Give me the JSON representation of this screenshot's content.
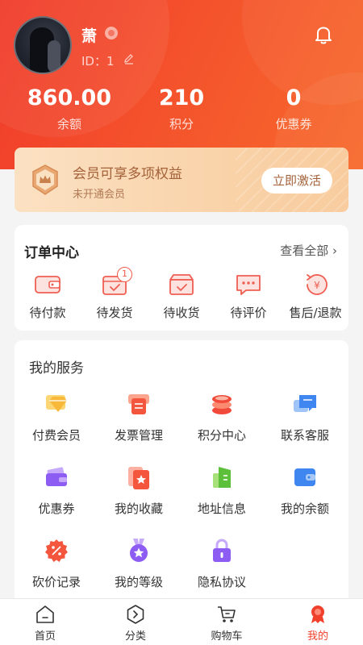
{
  "profile": {
    "username": "萧",
    "id_label": "ID：",
    "id_value": "1"
  },
  "stats": [
    {
      "value": "860.00",
      "label": "余额"
    },
    {
      "value": "210",
      "label": "积分"
    },
    {
      "value": "0",
      "label": "优惠券"
    }
  ],
  "member_banner": {
    "title": "会员可享多项权益",
    "subtitle": "未开通会员",
    "button": "立即激活"
  },
  "orders": {
    "title": "订单中心",
    "more": "查看全部",
    "items": [
      {
        "label": "待付款",
        "icon": "wallet-icon"
      },
      {
        "label": "待发货",
        "icon": "pending-ship-icon",
        "badge": "1"
      },
      {
        "label": "待收货",
        "icon": "receive-box-icon"
      },
      {
        "label": "待评价",
        "icon": "comment-icon"
      },
      {
        "label": "售后/退款",
        "icon": "refund-icon"
      }
    ]
  },
  "services": {
    "title": "我的服务",
    "items": [
      {
        "label": "付费会员",
        "icon": "diamond-icon"
      },
      {
        "label": "发票管理",
        "icon": "invoice-icon"
      },
      {
        "label": "积分中心",
        "icon": "coins-icon"
      },
      {
        "label": "联系客服",
        "icon": "chat-bubbles-icon"
      },
      {
        "label": "优惠券",
        "icon": "coupon-wallet-icon"
      },
      {
        "label": "我的收藏",
        "icon": "star-card-icon"
      },
      {
        "label": "地址信息",
        "icon": "address-icon"
      },
      {
        "label": "我的余额",
        "icon": "balance-wallet-icon"
      },
      {
        "label": "砍价记录",
        "icon": "discount-icon"
      },
      {
        "label": "我的等级",
        "icon": "medal-icon"
      },
      {
        "label": "隐私协议",
        "icon": "lock-icon"
      }
    ]
  },
  "tabbar": [
    {
      "label": "首页",
      "icon": "home-icon"
    },
    {
      "label": "分类",
      "icon": "category-icon"
    },
    {
      "label": "购物车",
      "icon": "cart-icon"
    },
    {
      "label": "我的",
      "icon": "profile-icon",
      "active": true
    }
  ],
  "colors": {
    "brand": "#f0402c",
    "gold_text": "#a4623a"
  }
}
